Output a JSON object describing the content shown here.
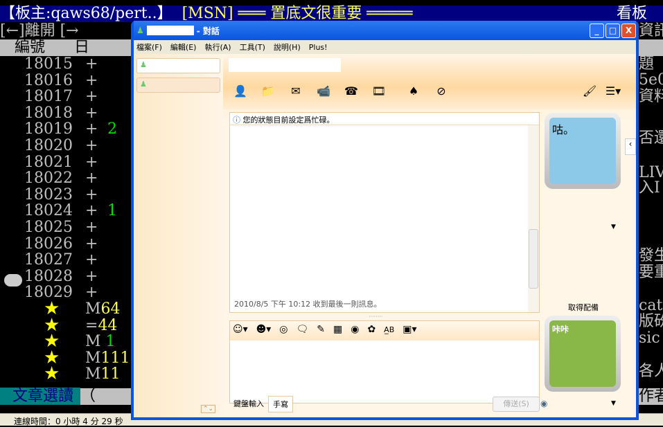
{
  "terminal": {
    "header_left": "【板主:qaws68/pert..】",
    "header_mid": "[MSN] ═══ 置底文很重要 ═════",
    "header_right": "看板",
    "line2": "[←]離開 [→",
    "line2_right": "資訊",
    "col_header": "   編號      日",
    "rows": [
      {
        "num": "18015",
        "cnt": ""
      },
      {
        "num": "18016",
        "cnt": ""
      },
      {
        "num": "18017",
        "cnt": ""
      },
      {
        "num": "18018",
        "cnt": ""
      },
      {
        "num": "18019",
        "cnt": "2"
      },
      {
        "num": "18020",
        "cnt": ""
      },
      {
        "num": "18021",
        "cnt": ""
      },
      {
        "num": "18022",
        "cnt": ""
      },
      {
        "num": "18023",
        "cnt": ""
      },
      {
        "num": "18024",
        "cnt": "1"
      },
      {
        "num": "18025",
        "cnt": ""
      },
      {
        "num": "18026",
        "cnt": ""
      },
      {
        "num": "18027",
        "cnt": ""
      },
      {
        "num": "18028",
        "cnt": ""
      },
      {
        "num": "18029",
        "cnt": ""
      }
    ],
    "plus": "+",
    "star_rows": [
      {
        "a": "M",
        "b": "64",
        "c": ""
      },
      {
        "a": "=",
        "b": "44",
        "c": ""
      },
      {
        "a": "M ",
        "b": "",
        "c": "1"
      },
      {
        "a": "M",
        "b": "111",
        "c": ""
      },
      {
        "a": "M",
        "b": "11",
        "c": ""
      }
    ],
    "star": "★",
    "right_fragments": [
      "題",
      "5e0",
      "資料",
      "否還",
      "LIV",
      "入Ⅰ",
      "發生",
      "要重",
      "cat",
      "版砏",
      "sic",
      "各人"
    ],
    "bottom_mode": "文章選讀",
    "bottom_paren": "（",
    "bottom_right": "作者",
    "status": "連線時間：0 小時 4 分 29 秒"
  },
  "window": {
    "title_suffix": "- 對話",
    "minimize": "_",
    "maximize": "□",
    "close": "X",
    "menu": [
      "檔案(F)",
      "編輯(E)",
      "執行(A)",
      "工具(T)",
      "說明(H)",
      "Plus!"
    ],
    "info_message": "您的狀態目前設定爲忙碌。",
    "last_message": "2010/8/5 下午 10:12 收到最後一則訊息。",
    "get_gear": "取得配備",
    "avatar1_text": "咕。",
    "avatar2_text": "咔咔",
    "tab_keyboard": "鍵盤輸入",
    "tab_handwriting": "手寫",
    "send_button": "傳送(S)"
  }
}
